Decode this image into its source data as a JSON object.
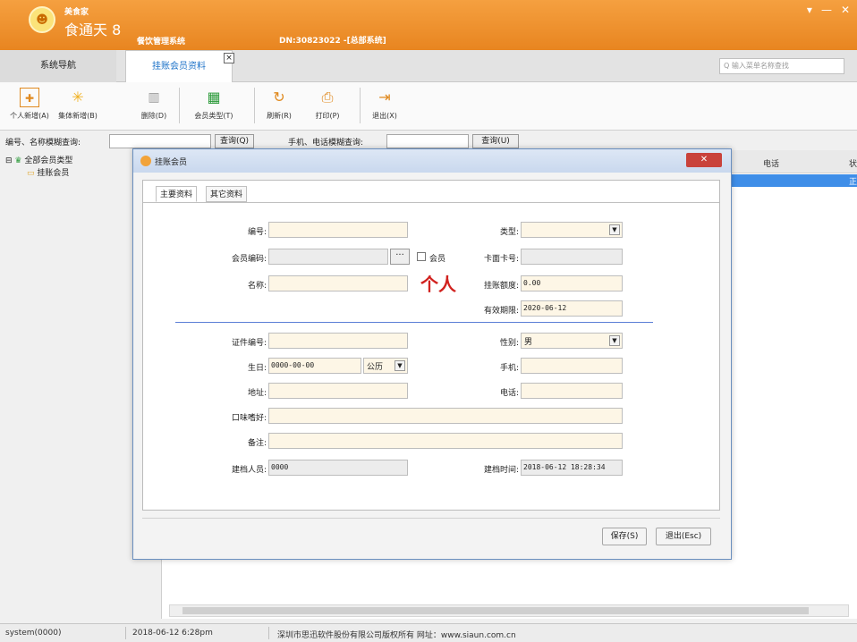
{
  "window": {
    "brand_small": "美食家",
    "brand_main": "食通天 8",
    "brand_sub": "餐饮管理系统",
    "dn": "DN:30823022 -[总部系统]",
    "controls": [
      "▾",
      "—",
      "✕"
    ]
  },
  "tabs": {
    "nav_label": "系统导航",
    "active_label": "挂账会员资料",
    "search_placeholder": "Q 输入菜单名称查找"
  },
  "toolbar": {
    "buttons": [
      {
        "label": "个人新增(A)",
        "icon": "plus-icon",
        "glyph": "✚"
      },
      {
        "label": "集体新增(B)",
        "icon": "sun-icon",
        "glyph": "✳"
      },
      {
        "label": "删除(D)",
        "icon": "trash-icon",
        "glyph": "🗑"
      },
      {
        "label": "会员类型(T)",
        "icon": "grid-icon",
        "glyph": "▦"
      },
      {
        "label": "刷新(R)",
        "icon": "refresh-icon",
        "glyph": "↻"
      },
      {
        "label": "打印(P)",
        "icon": "printer-icon",
        "glyph": "⎙"
      },
      {
        "label": "退出(X)",
        "icon": "exit-icon",
        "glyph": "⇥"
      }
    ]
  },
  "query": {
    "name_label": "编号、名称模糊查询:",
    "query_btn": "查询(Q)",
    "phone_label": "手机、电话模糊查询:",
    "query_btn2": "查询(U)"
  },
  "tree": {
    "root": "全部会员类型",
    "child": "挂账会员"
  },
  "grid": {
    "col_phone": "电话",
    "col_last": "状",
    "row_status": "正"
  },
  "dialog": {
    "title": "挂账会员",
    "close": "✕",
    "tab_main": "主要资料",
    "tab_other": "其它资料",
    "fields": {
      "code_label": "编号:",
      "type_label": "类型:",
      "card_label": "会员编码:",
      "member_chk_label": "会员",
      "card_face_label": "卡面卡号:",
      "name_label": "名称:",
      "person_tag": "个人",
      "credit_label": "挂账额度:",
      "credit_value": "0.00",
      "expire_label": "有效期限:",
      "expire_value": "2020-06-12",
      "id_label": "证件编号:",
      "gender_label": "性别:",
      "gender_value": "男",
      "birthday_label": "生日:",
      "birthday_value": "0000-00-00",
      "calendar_value": "公历",
      "mobile_label": "手机:",
      "address_label": "地址:",
      "phone_label": "电话:",
      "taste_label": "口味嗜好:",
      "note_label": "备注:",
      "creator_label": "建档人员:",
      "creator_value": "0000",
      "created_label": "建档时间:",
      "created_value": "2018-06-12 18:28:34",
      "ellipsis": "···"
    },
    "save_btn": "保存(S)",
    "exit_btn": "退出(Esc)"
  },
  "status": {
    "user": "system(0000)",
    "datetime": "2018-06-12 6:28pm",
    "copyright": "深圳市思迅软件股份有限公司版权所有 网址：www.siaun.com.cn"
  },
  "colors": {
    "titlebar": "#e88520",
    "accent_blue": "#1e73c8",
    "selected_row": "#3f8ee8",
    "red_tag": "#d1221f"
  }
}
